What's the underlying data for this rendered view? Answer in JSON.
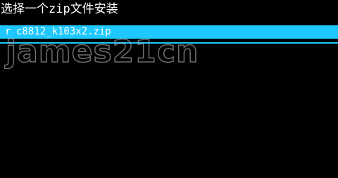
{
  "screen": {
    "title": "选择一个zip文件安装"
  },
  "file_list": {
    "items": [
      {
        "bullet": "r",
        "name": "c8812_k103x2.zip",
        "selected": true
      }
    ]
  },
  "watermark": {
    "text": "james21cn"
  },
  "colors": {
    "background": "#000000",
    "highlight": "#1ec8ff",
    "text": "#ffffff"
  }
}
